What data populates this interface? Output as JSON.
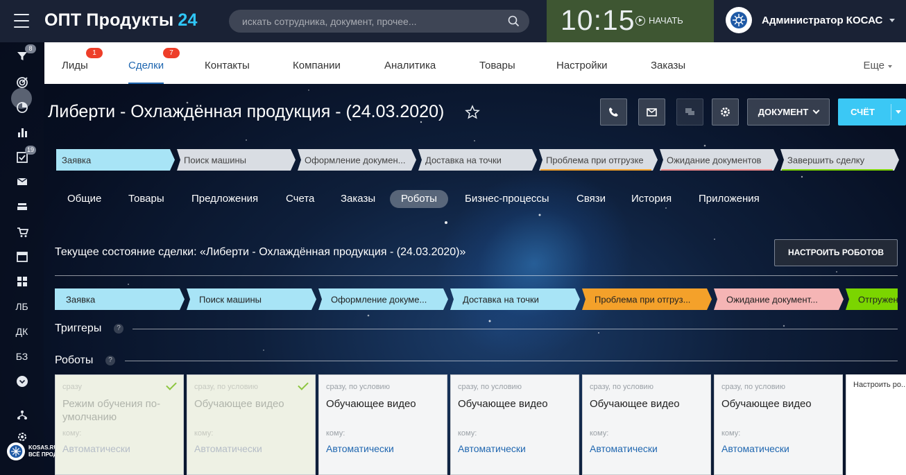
{
  "topbar": {
    "logo_main": "ОПТ Продукты",
    "logo_num": "24",
    "search_placeholder": "искать сотрудника, документ, прочее...",
    "clock": "10:15",
    "start_label": "НАЧАТЬ",
    "user_name": "Администратор КОСАС"
  },
  "sidebar": {
    "badges": {
      "filter": "8",
      "tasks": "19"
    },
    "text_items": [
      "ЛБ",
      "ДК",
      "БЗ"
    ],
    "bottom_logo_line1": "KOSAS.RU",
    "bottom_logo_line2": "ВСЁ ПРОДУКТ... ГОТОВО"
  },
  "menu": {
    "items": [
      {
        "label": "Лиды",
        "badge": "1"
      },
      {
        "label": "Сделки",
        "badge": "7"
      },
      {
        "label": "Контакты"
      },
      {
        "label": "Компании"
      },
      {
        "label": "Аналитика"
      },
      {
        "label": "Товары"
      },
      {
        "label": "Настройки"
      },
      {
        "label": "Заказы"
      }
    ],
    "more": "Еще"
  },
  "deal": {
    "title": "Либерти - Охлаждённая продукция - (24.03.2020)",
    "document_btn": "ДОКУМЕНТ",
    "invoice_btn": "СЧЁТ"
  },
  "stages": [
    {
      "label": "Заявка",
      "color": "#a8e4f6",
      "text": "#333333",
      "bar": ""
    },
    {
      "label": "Поиск машины",
      "color": "#d9dde3",
      "text": "#444444",
      "bar": ""
    },
    {
      "label": "Оформление докумен...",
      "color": "#d9dde3",
      "text": "#444444",
      "bar": ""
    },
    {
      "label": "Доставка на точки",
      "color": "#d9dde3",
      "text": "#444444",
      "bar": ""
    },
    {
      "label": "Проблема при отгрузке",
      "color": "#d9dde3",
      "text": "#444444",
      "bar": "#f4a12a"
    },
    {
      "label": "Ожидание документов",
      "color": "#d9dde3",
      "text": "#444444",
      "bar": "#f28b8b"
    },
    {
      "label": "Завершить сделку",
      "color": "#d9dde3",
      "text": "#444444",
      "bar": "#7bd500"
    }
  ],
  "tabs": [
    "Общие",
    "Товары",
    "Предложения",
    "Счета",
    "Заказы",
    "Роботы",
    "Бизнес-процессы",
    "Связи",
    "История",
    "Приложения"
  ],
  "robots": {
    "state_text": "Текущее состояние сделки: «Либерти - Охлаждённая продукция - (24.03.2020)»",
    "configure_btn": "НАСТРОИТЬ РОБОТОВ",
    "triggers_title": "Триггеры",
    "robots_title": "Роботы",
    "help": "?",
    "stages": [
      {
        "label": "Заявка",
        "color": "#a8e4f6"
      },
      {
        "label": "Поиск машины",
        "color": "#a8e4f6"
      },
      {
        "label": "Оформление докуме...",
        "color": "#a8e4f6"
      },
      {
        "label": "Доставка на точки",
        "color": "#a8e4f6"
      },
      {
        "label": "Проблема при отгруз...",
        "color": "#f4a12a"
      },
      {
        "label": "Ожидание документ...",
        "color": "#f5b5b5"
      },
      {
        "label": "Отгружен...",
        "color": "#7bd500"
      }
    ],
    "cards": [
      {
        "when": "сразу",
        "name": "Режим обучения по-умолчанию",
        "to_label": "кому:",
        "who": "Автоматически",
        "done": true
      },
      {
        "when": "сразу, по условию",
        "name": "Обучающее видео",
        "to_label": "кому:",
        "who": "Автоматически",
        "done": true
      },
      {
        "when": "сразу, по условию",
        "name": "Обучающее видео",
        "to_label": "кому:",
        "who": "Автоматически",
        "done": false
      },
      {
        "when": "сразу, по условию",
        "name": "Обучающее видео",
        "to_label": "кому:",
        "who": "Автоматически",
        "done": false
      },
      {
        "when": "сразу, по условию",
        "name": "Обучающее видео",
        "to_label": "кому:",
        "who": "Автоматически",
        "done": false
      },
      {
        "when": "сразу, по условию",
        "name": "Обучающее видео",
        "to_label": "кому:",
        "who": "Автоматически",
        "done": false
      }
    ],
    "configure_link": "Настроить ро..."
  }
}
